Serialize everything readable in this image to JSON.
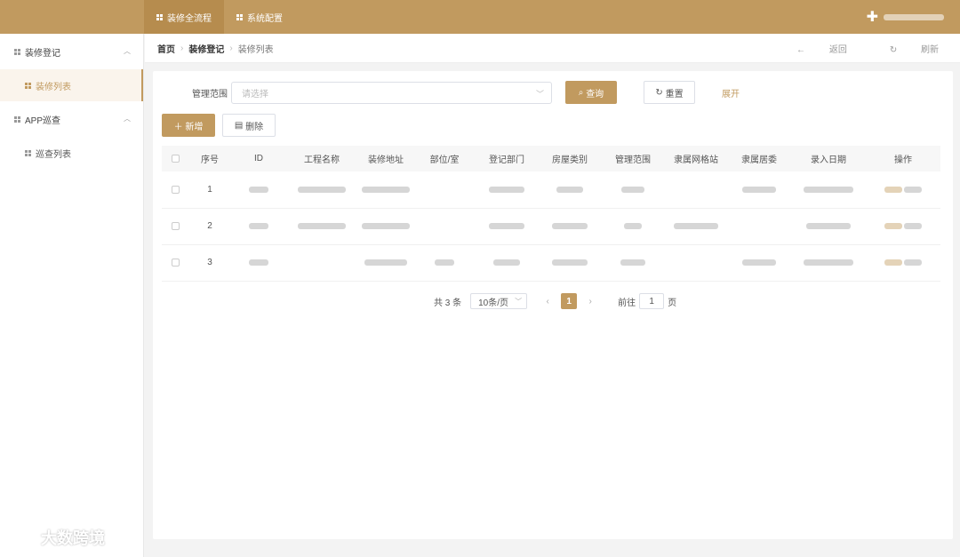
{
  "topnav": {
    "tabs": [
      {
        "label": "装修全流程",
        "active": true
      },
      {
        "label": "系统配置",
        "active": false
      }
    ]
  },
  "user": {
    "name": ""
  },
  "sidebar": {
    "groups": [
      {
        "label": "装修登记",
        "items": [
          {
            "label": "装修列表",
            "active": true
          }
        ]
      },
      {
        "label": "APP巡查",
        "items": [
          {
            "label": "巡查列表",
            "active": false
          }
        ]
      }
    ]
  },
  "breadcrumb": {
    "items": [
      "首页",
      "装修登记",
      "装修列表"
    ],
    "back_label": "返回",
    "refresh_label": "刷新"
  },
  "filter": {
    "label": "管理范围",
    "placeholder": "请选择",
    "search_label": "查询",
    "reset_label": "重置",
    "expand_label": "展开"
  },
  "actions": {
    "add_label": "新增",
    "delete_label": "删除"
  },
  "table": {
    "columns": [
      "序号",
      "ID",
      "工程名称",
      "装修地址",
      "部位/室",
      "登记部门",
      "房屋类别",
      "管理范围",
      "隶属网格站",
      "隶属居委",
      "录入日期",
      "操作"
    ],
    "rows": [
      {
        "index": "1"
      },
      {
        "index": "2"
      },
      {
        "index": "3"
      }
    ]
  },
  "pagination": {
    "total_label": "共 3 条",
    "page_size": "10条/页",
    "current_page": "1",
    "goto_label": "前往",
    "goto_value": "1",
    "page_unit": "页"
  },
  "watermark": {
    "text": "大数跨境"
  },
  "colors": {
    "brand": "#c19a5f",
    "brand_dark": "#b68c4e"
  }
}
